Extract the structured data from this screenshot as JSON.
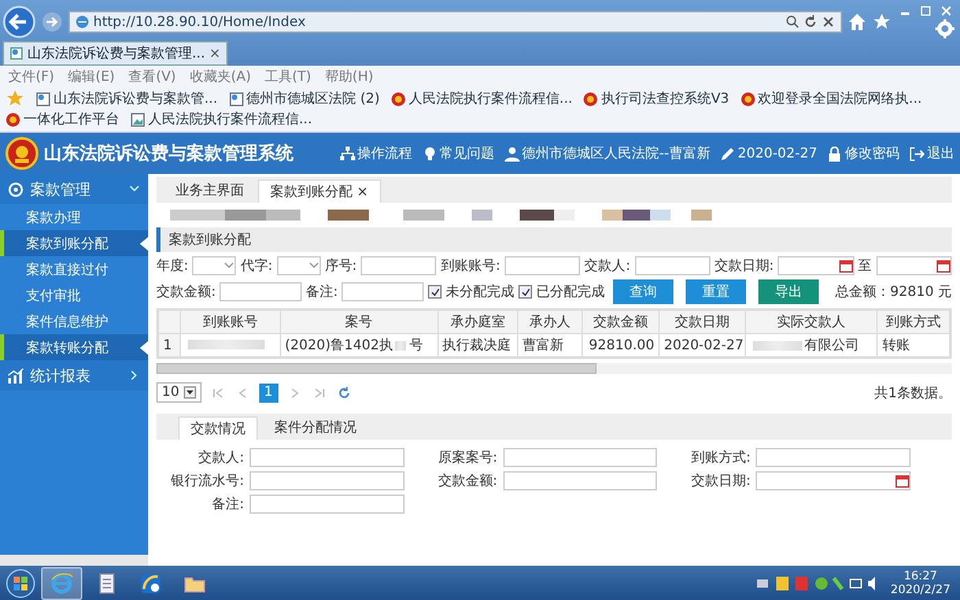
{
  "browser": {
    "url": "http://10.28.90.10/Home/Index",
    "tab": {
      "label": "山东法院诉讼费与案款管理...",
      "close": "×"
    },
    "menu": [
      "文件(F)",
      "编辑(E)",
      "查看(V)",
      "收藏夹(A)",
      "工具(T)",
      "帮助(H)"
    ],
    "favorites": [
      {
        "label": "山东法院诉讼费与案款管...",
        "kind": "page"
      },
      {
        "label": "德州市德城区法院 (2)",
        "kind": "page"
      },
      {
        "label": "人民法院执行案件流程信...",
        "kind": "emblem"
      },
      {
        "label": "执行司法查控系统V3",
        "kind": "emblem"
      },
      {
        "label": "欢迎登录全国法院网络执...",
        "kind": "emblem"
      },
      {
        "label": "一体化工作平台",
        "kind": "emblem"
      },
      {
        "label": "人民法院执行案件流程信...",
        "kind": "image"
      }
    ]
  },
  "header": {
    "title": "山东法院诉讼费与案款管理系统",
    "nav": [
      {
        "label": "操作流程",
        "kind": "flow"
      },
      {
        "label": "常见问题",
        "kind": "tip"
      },
      {
        "label": "德州市德城区人民法院--曹富新",
        "kind": "user"
      },
      {
        "label": "2020-02-27",
        "kind": "edit"
      },
      {
        "label": "修改密码",
        "kind": "lock"
      },
      {
        "label": "退出",
        "kind": "logout"
      }
    ]
  },
  "sidebar": {
    "groups": [
      {
        "label": "案款管理",
        "kind": "money",
        "expanded": true,
        "children": [
          {
            "label": "案款办理",
            "selected": false
          },
          {
            "label": "案款到账分配",
            "selected": true
          },
          {
            "label": "案款直接过付",
            "selected": false
          },
          {
            "label": "支付审批",
            "selected": false
          },
          {
            "label": "案件信息维护",
            "selected": false
          },
          {
            "label": "案款转账分配",
            "selected": true
          }
        ]
      },
      {
        "label": "统计报表",
        "kind": "chart",
        "expanded": false
      }
    ]
  },
  "tabs": [
    {
      "label": "业务主界面",
      "selected": false
    },
    {
      "label": "案款到账分配",
      "selected": true,
      "close": "×"
    }
  ],
  "panel_title": "案款到账分配",
  "filters": [
    [
      {
        "kind": "select",
        "label": "年度:"
      },
      {
        "kind": "select",
        "label": "代字:"
      },
      {
        "kind": "input",
        "label": "序号:"
      },
      {
        "kind": "input",
        "label": "到账账号:"
      },
      {
        "kind": "input",
        "label": "交款人:"
      },
      {
        "kind": "date",
        "label": "交款日期:"
      },
      {
        "kind": "date",
        "label": "至"
      }
    ],
    [
      {
        "kind": "input",
        "label": "交款金额:"
      },
      {
        "kind": "input",
        "label": "备注:"
      },
      {
        "kind": "checkbox",
        "label": "未分配完成",
        "checked": true
      },
      {
        "kind": "checkbox",
        "label": "已分配完成",
        "checked": true
      },
      {
        "kind": "button",
        "label": "查询",
        "color": "#1e8fd6"
      },
      {
        "kind": "button",
        "label": "重置",
        "color": "#1e8fd6"
      },
      {
        "kind": "button",
        "label": "导出",
        "color": "#14937a"
      },
      {
        "kind": "total",
        "label": "总金额：92810 元"
      }
    ]
  ],
  "table": {
    "columns": [
      {
        "label": "到账账号",
        "kind": "text"
      },
      {
        "label": "案号",
        "kind": "text"
      },
      {
        "label": "承办庭室",
        "kind": "text"
      },
      {
        "label": "承办人",
        "kind": "text"
      },
      {
        "label": "交款金额",
        "kind": "number"
      },
      {
        "label": "交款日期",
        "kind": "center"
      },
      {
        "label": "实际交款人",
        "kind": "text"
      },
      {
        "label": "到账方式",
        "kind": "text"
      }
    ],
    "rows": [
      {
        "index": "1",
        "cells": [
          {
            "parts": [
              {
                "kind": "redacted"
              }
            ]
          },
          {
            "parts": [
              {
                "kind": "text",
                "text": "(2020)鲁1402执"
              },
              {
                "kind": "redacted"
              },
              {
                "kind": "text",
                "text": "号"
              }
            ]
          },
          {
            "parts": [
              {
                "kind": "text",
                "text": "执行裁决庭"
              }
            ]
          },
          {
            "parts": [
              {
                "kind": "text",
                "text": "曹富新"
              }
            ]
          },
          {
            "parts": [
              {
                "kind": "text",
                "text": "92810.00"
              }
            ]
          },
          {
            "parts": [
              {
                "kind": "text",
                "text": "2020-02-27"
              }
            ]
          },
          {
            "parts": [
              {
                "kind": "redacted"
              },
              {
                "kind": "text",
                "text": "有限公司"
              }
            ]
          },
          {
            "parts": [
              {
                "kind": "text",
                "text": "转账"
              }
            ]
          }
        ]
      }
    ]
  },
  "pager": {
    "page_size": "10",
    "pages": [
      {
        "label": "1",
        "selected": true
      }
    ],
    "info": "共1条数据。"
  },
  "detail": {
    "tabs": [
      {
        "label": "交款情况",
        "selected": true
      },
      {
        "label": "案件分配情况",
        "selected": false
      }
    ],
    "fields": [
      {
        "label": "交款人:",
        "kind": "text"
      },
      {
        "label": "原案案号:",
        "kind": "text"
      },
      {
        "label": "到账方式:",
        "kind": "text"
      },
      {
        "label": "银行流水号:",
        "kind": "text"
      },
      {
        "label": "交款金额:",
        "kind": "text"
      },
      {
        "label": "交款日期:",
        "kind": "date"
      },
      {
        "label": "备注:",
        "kind": "text"
      }
    ]
  },
  "taskbar": {
    "apps": [
      {
        "kind": "ie",
        "selected": true
      },
      {
        "kind": "document",
        "selected": false
      },
      {
        "kind": "app",
        "selected": false
      },
      {
        "kind": "folder",
        "selected": false
      }
    ],
    "time": "16:27",
    "date": "2020/2/27"
  }
}
